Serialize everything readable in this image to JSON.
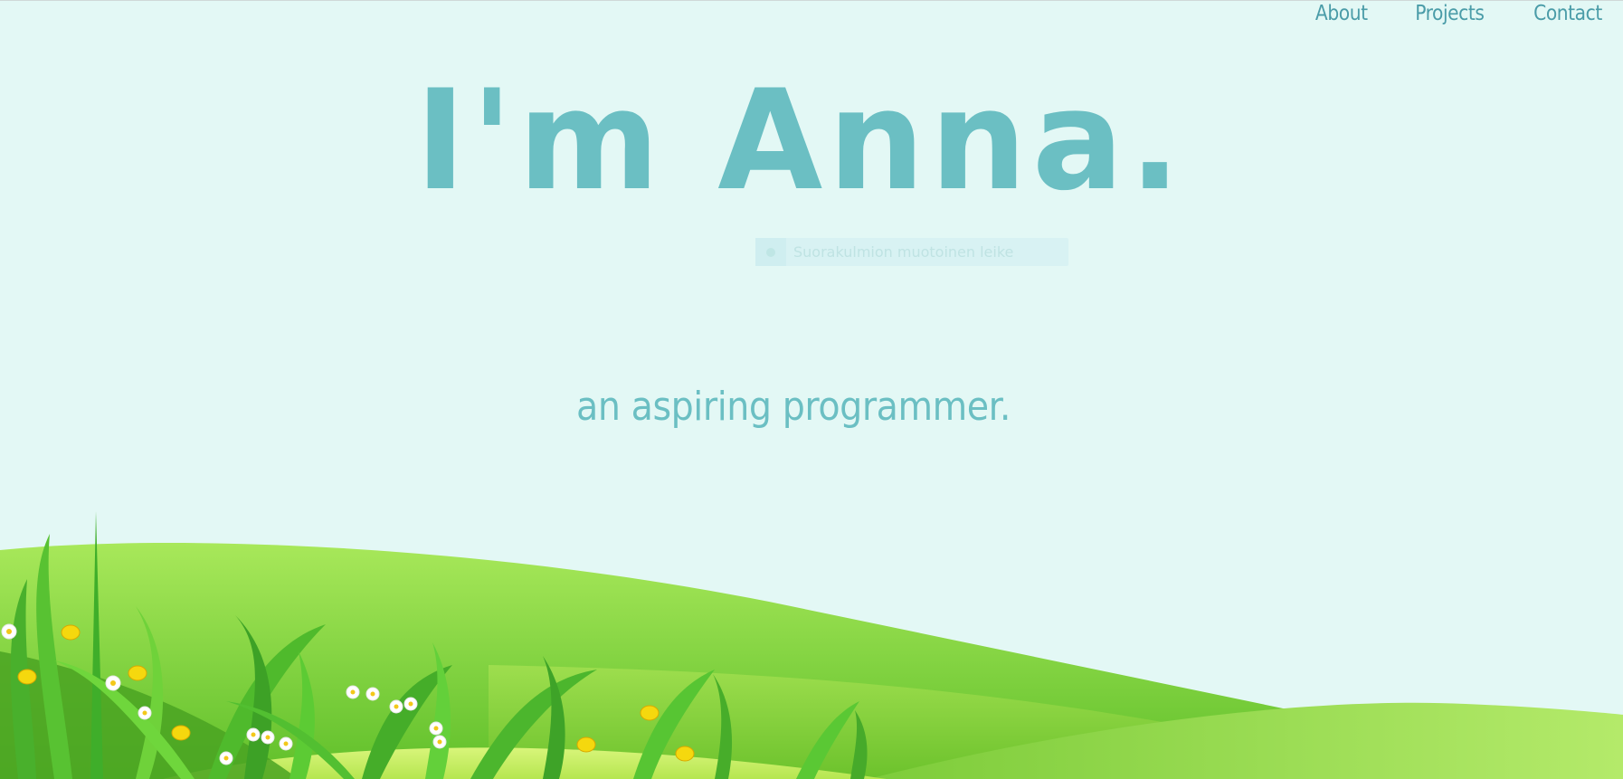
{
  "nav": {
    "items": [
      {
        "label": "About"
      },
      {
        "label": "Projects"
      },
      {
        "label": "Contact"
      }
    ]
  },
  "hero": {
    "title": "I'm Anna.",
    "subtitle": "an aspiring programmer."
  },
  "snip_tooltip": {
    "label": "Suorakulmion muotoinen leike",
    "icon": "snip-record-icon"
  },
  "colors": {
    "background": "#e3f8f5",
    "accent": "#6bbfc3",
    "nav_text": "#4a9ca8",
    "grass_light": "#a6e85a",
    "grass_dark": "#45a820"
  }
}
